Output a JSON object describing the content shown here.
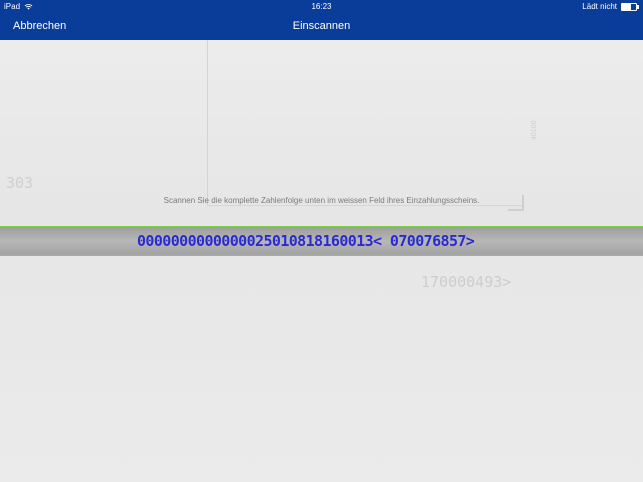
{
  "status_bar": {
    "device": "iPad",
    "time": "16:23",
    "charging": "Lädt nicht"
  },
  "nav": {
    "cancel": "Abbrechen",
    "title": "Einscannen"
  },
  "scanner": {
    "instruction": "Scannen Sie die komplette Zahlenfolge unten im weissen Feld ihres Einzahlungsscheins.",
    "recognized_code": "0000000000000025010818160013< 070076857>",
    "background_number_left": "303",
    "background_number_below": "170000493>",
    "side_number": "40100"
  },
  "colors": {
    "nav_bg": "#0a3d9a",
    "scan_highlight": "#2a2ad0",
    "scan_border": "#7fd14a"
  }
}
